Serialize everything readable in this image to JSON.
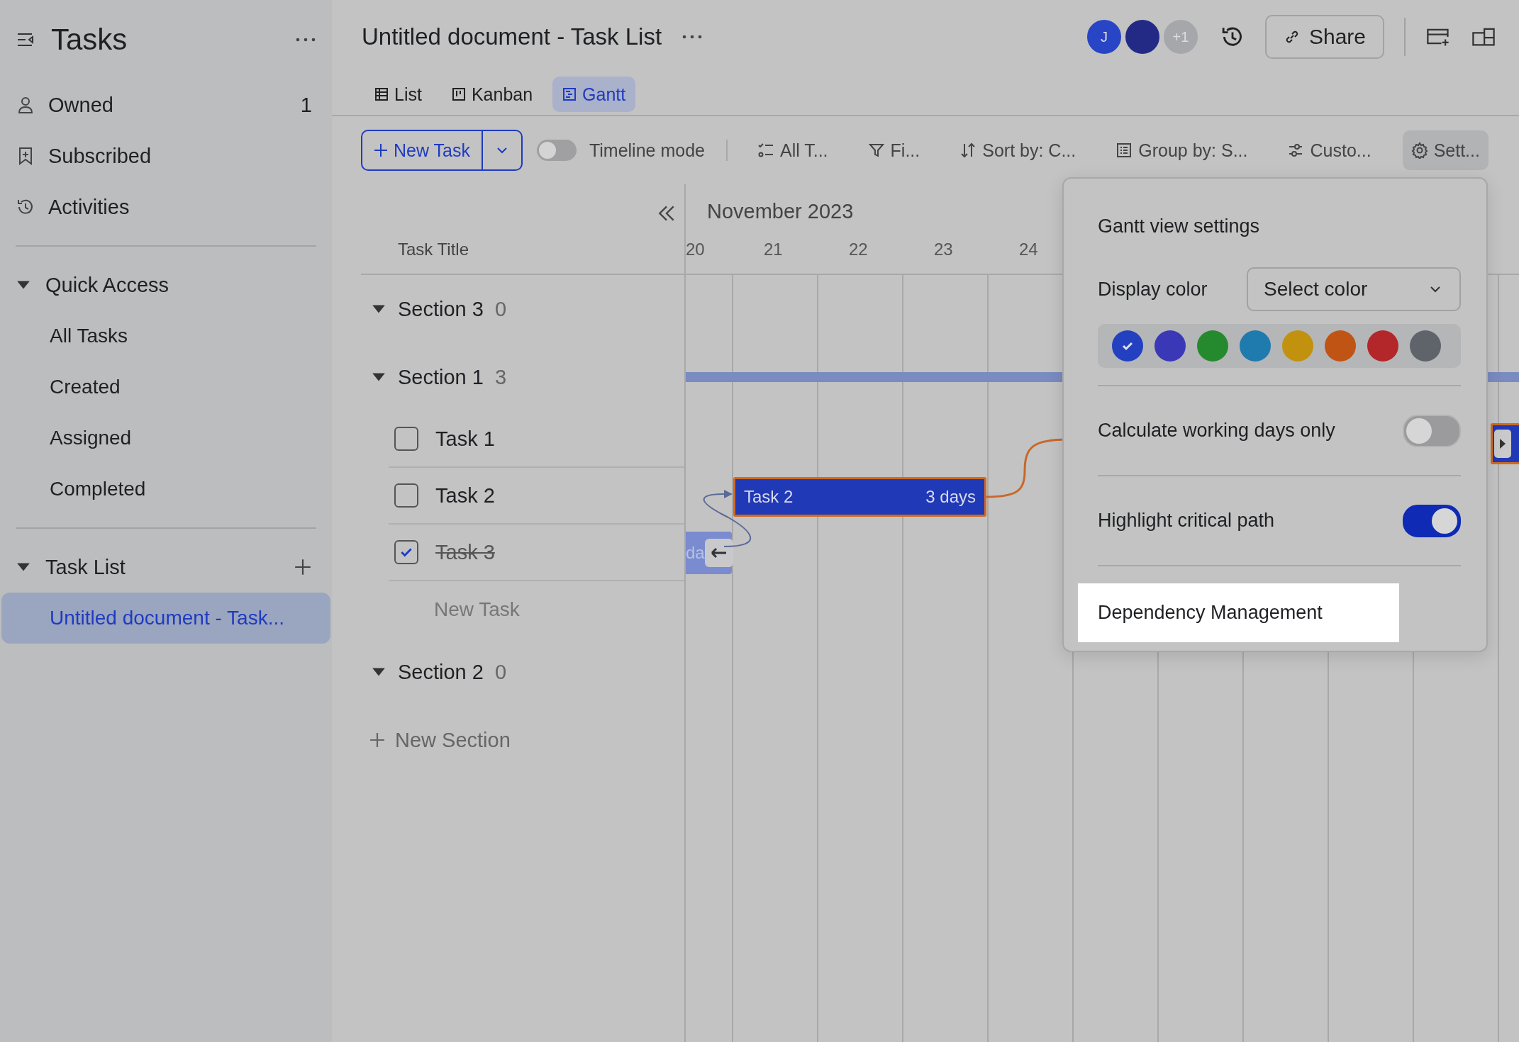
{
  "sidebar": {
    "title": "Tasks",
    "items": [
      {
        "label": "Owned",
        "count": "1"
      },
      {
        "label": "Subscribed"
      },
      {
        "label": "Activities"
      }
    ],
    "groups": [
      {
        "label": "Quick Access",
        "expanded": true,
        "items": [
          {
            "label": "All Tasks",
            "selected": false
          },
          {
            "label": "Created",
            "selected": false
          },
          {
            "label": "Assigned",
            "selected": false
          },
          {
            "label": "Completed",
            "selected": false
          }
        ]
      },
      {
        "label": "Task List",
        "expanded": true,
        "items": [
          {
            "label": "Untitled document - Task...",
            "selected": true
          }
        ]
      }
    ]
  },
  "header": {
    "title": "Untitled document - Task List",
    "avatars": [
      {
        "text": "J",
        "color": "#2845c6"
      },
      {
        "color": "#232a86"
      },
      {
        "text": "+1",
        "color": "#a6a7ab"
      }
    ],
    "share": "Share"
  },
  "tabs": [
    {
      "label": "List",
      "selected": false
    },
    {
      "label": "Kanban",
      "selected": false
    },
    {
      "label": "Gantt",
      "selected": true
    }
  ],
  "toolbar": {
    "new_task": "New Task",
    "timeline_mode": {
      "label": "Timeline mode",
      "on": false
    },
    "tools": [
      {
        "label": "All T...",
        "active": false
      },
      {
        "label": "Fi...",
        "active": false
      },
      {
        "label": "Sort by: C...",
        "active": false
      },
      {
        "label": "Group by: S...",
        "active": false
      },
      {
        "label": "Custo...",
        "active": false
      },
      {
        "label": "Sett...",
        "active": true
      }
    ]
  },
  "task_panel": {
    "column_title": "Task Title",
    "sections": [
      {
        "title": "Section 3",
        "count": "0",
        "expanded": true
      },
      {
        "title": "Section 1",
        "count": "3",
        "expanded": true,
        "tasks": [
          {
            "title": "Task 1",
            "checked": false
          },
          {
            "title": "Task 2",
            "checked": false
          },
          {
            "title": "Task 3",
            "checked": true
          }
        ],
        "new_task": "New Task"
      },
      {
        "title": "Section 2",
        "count": "0",
        "expanded": true
      }
    ],
    "new_section": "New Section"
  },
  "gantt": {
    "month": "November 2023",
    "days": [
      "20",
      "21",
      "22",
      "23",
      "24"
    ],
    "bars": [
      {
        "kind": "summary"
      },
      {
        "kind": "task",
        "label": "Task 2",
        "duration": "3 days",
        "critical": true,
        "done": false
      },
      {
        "kind": "task",
        "label": "da",
        "critical": false,
        "done": true
      },
      {
        "kind": "task",
        "critical": true,
        "done": false
      }
    ]
  },
  "settings": {
    "title": "Gantt view settings",
    "display_color": {
      "label": "Display color",
      "value": "Select color"
    },
    "swatches": [
      {
        "color": "#2340c0",
        "selected": true
      },
      {
        "color": "#3b38b8",
        "selected": false
      },
      {
        "color": "#258a2e",
        "selected": false
      },
      {
        "color": "#1f7aae",
        "selected": false
      },
      {
        "color": "#c2910e",
        "selected": false
      },
      {
        "color": "#c05415",
        "selected": false
      },
      {
        "color": "#b3262a",
        "selected": false
      },
      {
        "color": "#5f646b",
        "selected": false
      }
    ],
    "options": [
      {
        "label": "Calculate working days only",
        "on": false
      },
      {
        "label": "Highlight critical path",
        "on": true
      }
    ],
    "link": "Dependency Management"
  }
}
